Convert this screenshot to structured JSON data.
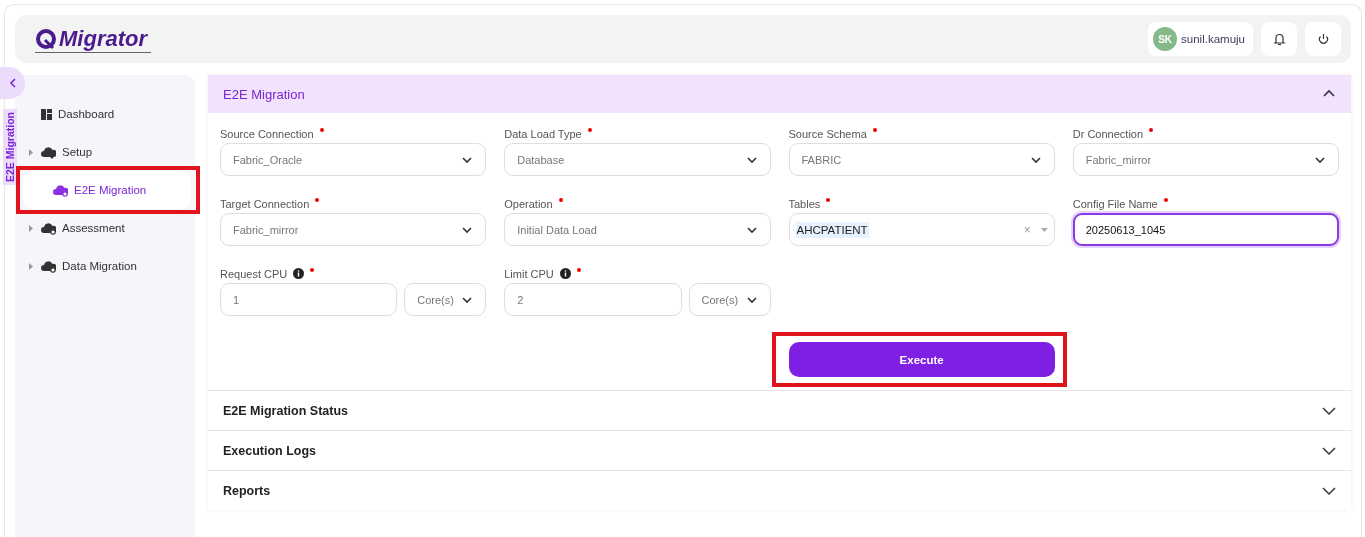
{
  "header": {
    "logo": "Migrator",
    "user": {
      "initials": "SK",
      "name": "sunil.kamuju"
    }
  },
  "side_tab": {
    "label": "E2E Migration"
  },
  "sidebar": {
    "items": [
      {
        "label": "Dashboard",
        "expandable": false,
        "selected": false,
        "highlighted": false
      },
      {
        "label": "Setup",
        "expandable": true,
        "selected": false,
        "highlighted": false
      },
      {
        "label": "E2E Migration",
        "expandable": false,
        "selected": true,
        "highlighted": true
      },
      {
        "label": "Assessment",
        "expandable": true,
        "selected": false,
        "highlighted": false
      },
      {
        "label": "Data Migration",
        "expandable": true,
        "selected": false,
        "highlighted": false
      }
    ]
  },
  "panel": {
    "title": "E2E Migration",
    "expanded": true,
    "fields": [
      {
        "label": "Source Connection",
        "required": true,
        "kind": "select",
        "value": "Fabric_Oracle"
      },
      {
        "label": "Data Load Type",
        "required": true,
        "kind": "select",
        "value": "Database"
      },
      {
        "label": "Source Schema",
        "required": true,
        "kind": "select",
        "value": "FABRIC"
      },
      {
        "label": "Dr Connection",
        "required": true,
        "kind": "select",
        "value": "Fabric_mirror"
      },
      {
        "label": "Target Connection",
        "required": true,
        "kind": "select",
        "value": "Fabric_mirror"
      },
      {
        "label": "Operation",
        "required": true,
        "kind": "select",
        "value": "Initial Data Load"
      },
      {
        "label": "Tables",
        "required": true,
        "kind": "tags",
        "tags": [
          "AHCPATIENT"
        ],
        "clear": "×"
      },
      {
        "label": "Config File Name",
        "required": true,
        "kind": "text",
        "value": "20250613_1045",
        "focused": true
      },
      {
        "label": "Request CPU",
        "required": true,
        "kind": "cpu",
        "info": true,
        "value": "1",
        "unit": "Core(s)"
      },
      {
        "label": "Limit CPU",
        "required": true,
        "kind": "cpu",
        "info": true,
        "value": "2",
        "unit": "Core(s)"
      }
    ],
    "button": {
      "label": "Execute",
      "highlighted": true
    }
  },
  "sections": [
    {
      "title": "E2E Migration Status",
      "expanded": false
    },
    {
      "title": "Execution Logs",
      "expanded": false
    },
    {
      "title": "Reports",
      "expanded": false
    }
  ]
}
